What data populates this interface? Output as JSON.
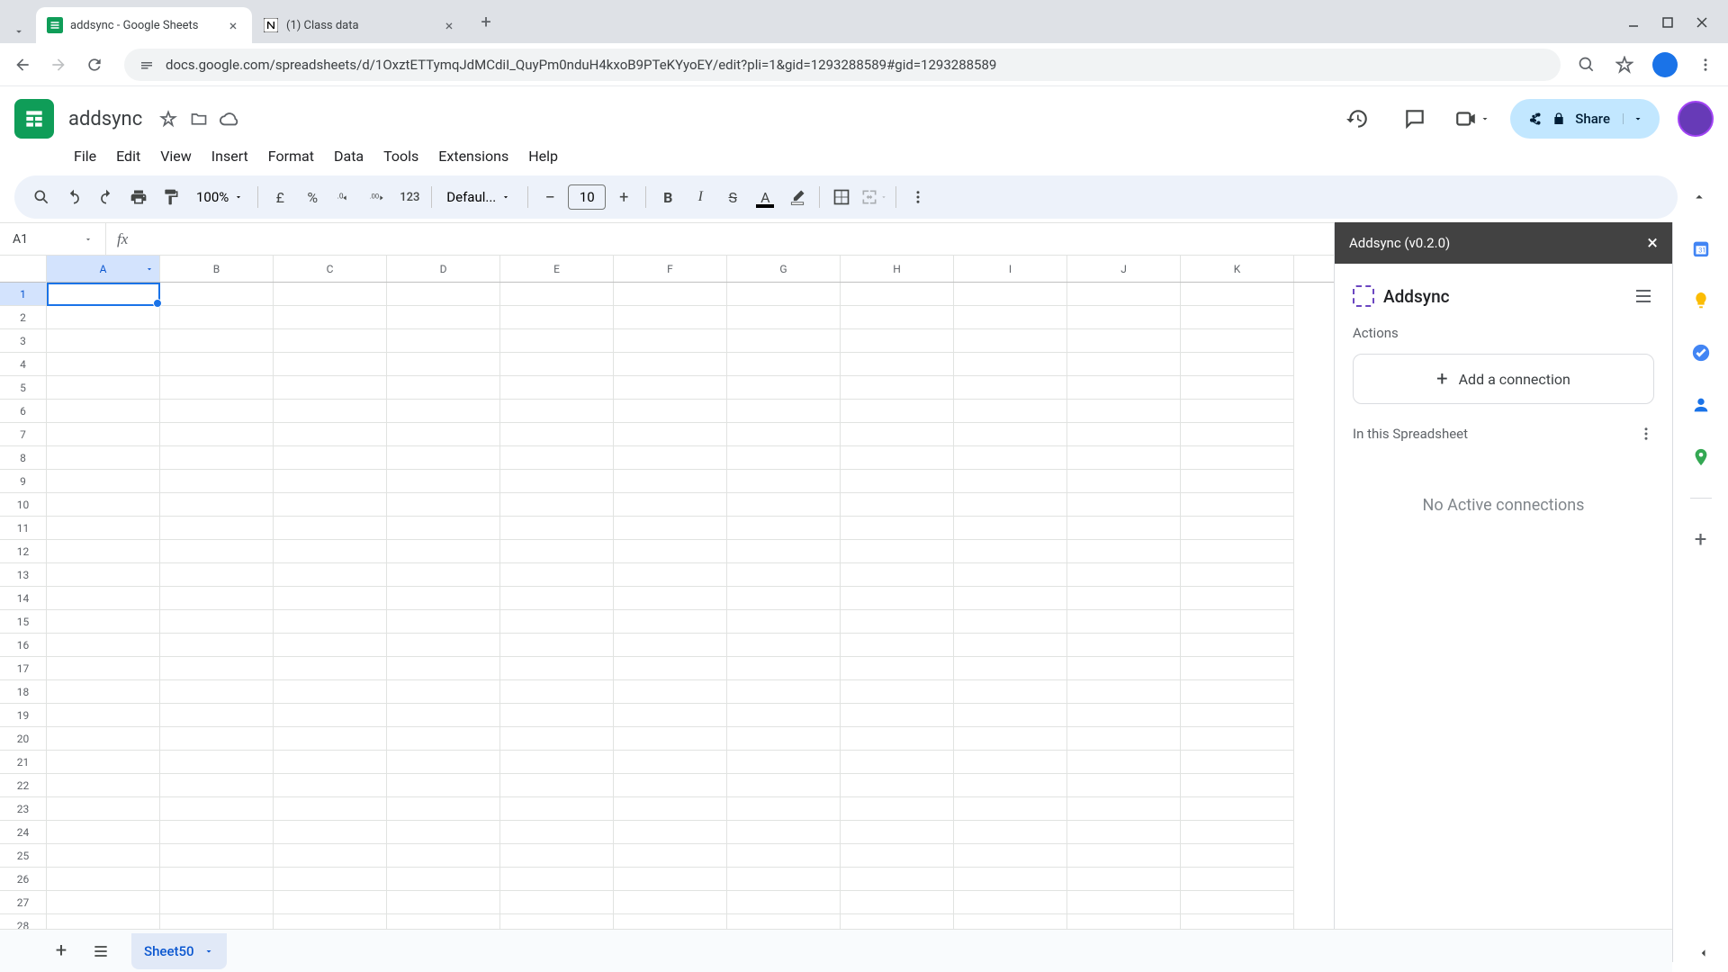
{
  "browser": {
    "tabs": [
      {
        "title": "addsync - Google Sheets",
        "favicon": "sheets",
        "active": true
      },
      {
        "title": "(1) Class data",
        "favicon": "notion",
        "active": false
      }
    ],
    "url": "docs.google.com/spreadsheets/d/1OxztETTymqJdMCdiI_QuyPm0nduH4kxoB9PTeKYyoEY/edit?pli=1&gid=1293288589#gid=1293288589"
  },
  "doc": {
    "title": "addsync",
    "menus": [
      "File",
      "Edit",
      "View",
      "Insert",
      "Format",
      "Data",
      "Tools",
      "Extensions",
      "Help"
    ]
  },
  "toolbar": {
    "zoom": "100%",
    "currency": "£",
    "percent": "%",
    "format123": "123",
    "font": "Defaul...",
    "fontSize": "10"
  },
  "share": {
    "label": "Share"
  },
  "grid": {
    "nameBox": "A1",
    "columns": [
      "A",
      "B",
      "C",
      "D",
      "E",
      "F",
      "G",
      "H",
      "I",
      "J",
      "K"
    ],
    "rowCount": 28,
    "selectedCell": {
      "row": 1,
      "col": "A"
    }
  },
  "sidePanel": {
    "header": "Addsync (v0.2.0)",
    "brand": "Addsync",
    "actionsLabel": "Actions",
    "addButton": "Add a connection",
    "inSheetLabel": "In this Spreadsheet",
    "emptyState": "No Active connections"
  },
  "footer": {
    "activeSheet": "Sheet50"
  }
}
